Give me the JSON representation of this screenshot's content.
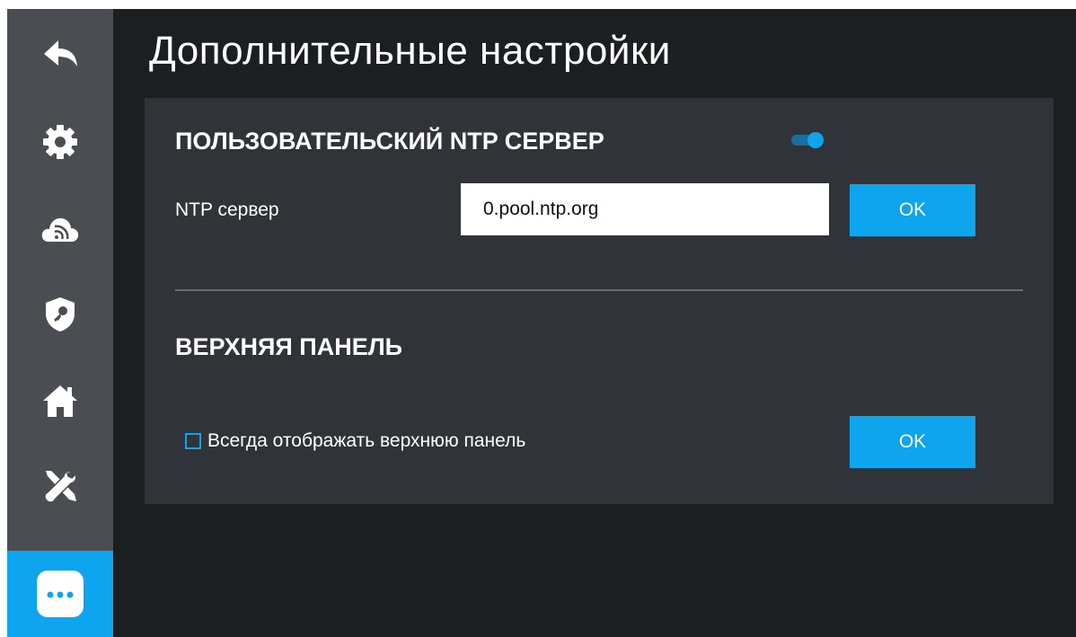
{
  "page_title": "Дополнительные настройки",
  "sidebar": {
    "items": [
      {
        "name": "back-arrow-icon",
        "active": false
      },
      {
        "name": "gear-icon",
        "active": false
      },
      {
        "name": "cloud-signal-icon",
        "active": false
      },
      {
        "name": "shield-key-icon",
        "active": false
      },
      {
        "name": "home-icon",
        "active": false
      },
      {
        "name": "tools-icon",
        "active": false
      },
      {
        "name": "more-icon",
        "active": true
      }
    ]
  },
  "ntp_section": {
    "title": "ПОЛЬЗОВАТЕЛЬСКИЙ NTP СЕРВЕР",
    "toggle_on": true,
    "field_label": "NTP сервер",
    "field_value": "0.pool.ntp.org",
    "ok_label": "OK"
  },
  "top_panel_section": {
    "title": "ВЕРХНЯЯ ПАНЕЛЬ",
    "checkbox_label": "Всегда отображать верхнюю панель",
    "checkbox_checked": false,
    "ok_label": "OK"
  },
  "colors": {
    "accent": "#0ea4ee",
    "background": "#1c1f22",
    "sidebar": "#4a4d51",
    "panel": "#303338"
  }
}
